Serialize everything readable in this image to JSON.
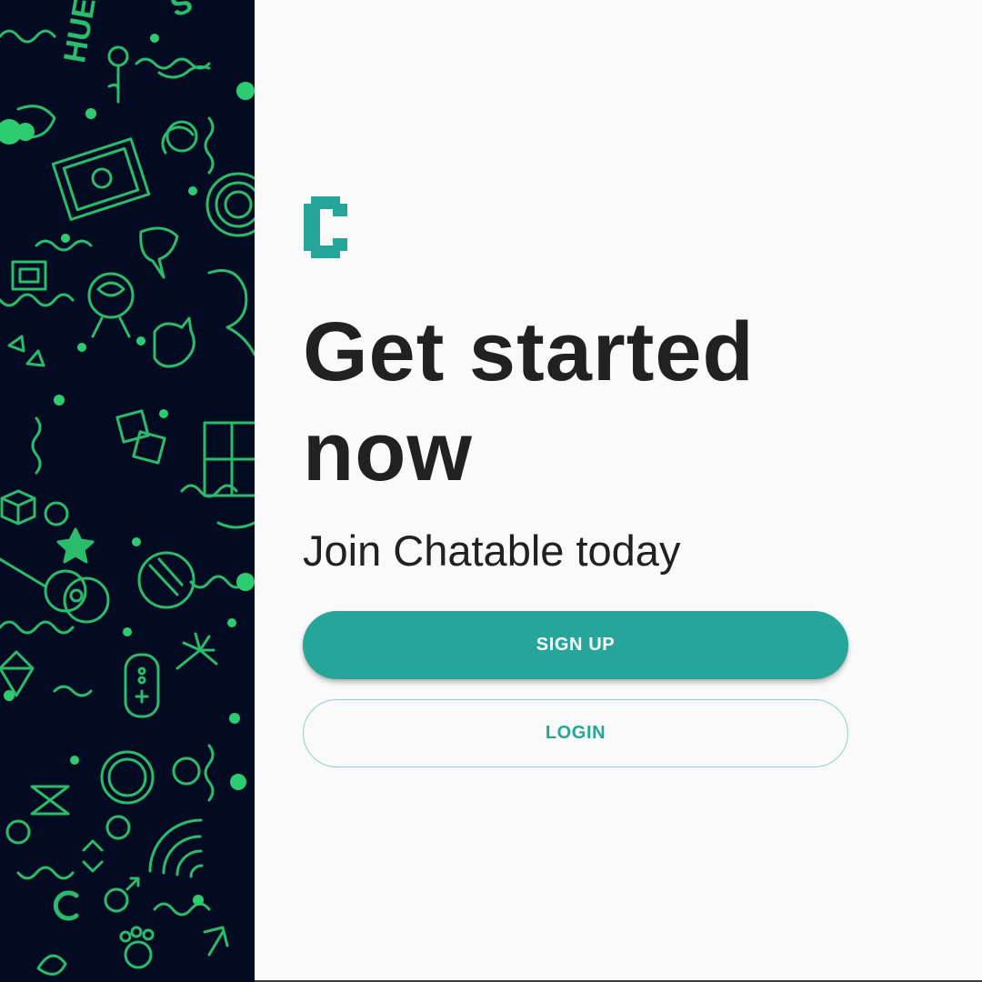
{
  "colors": {
    "accent": "#26a69a",
    "pattern_background": "#020b22",
    "pattern_stroke": "#2ecc71",
    "text": "#212121",
    "page_background": "#fafafa"
  },
  "background_pattern": {
    "icon": "doodle-pattern-icon",
    "lettering": [
      "HUE",
      "S",
      "C"
    ]
  },
  "logo": {
    "icon": "chatable-logo-icon"
  },
  "hero": {
    "headline": "Get started now",
    "subheadline": "Join Chatable today"
  },
  "actions": {
    "signup_label": "SIGN UP",
    "login_label": "LOGIN"
  }
}
